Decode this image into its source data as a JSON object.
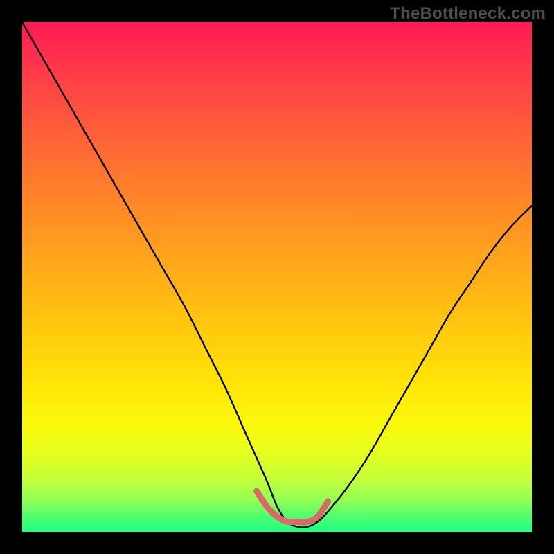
{
  "watermark": "TheBottleneck.com",
  "colors": {
    "frame": "#000000",
    "curve": "#000000",
    "highlight": "#d96a6a",
    "gradient_top": "#ff1a55",
    "gradient_bottom": "#1fff83"
  },
  "chart_data": {
    "type": "line",
    "title": "",
    "xlabel": "",
    "ylabel": "",
    "xlim": [
      0,
      100
    ],
    "ylim": [
      0,
      100
    ],
    "grid": false,
    "legend": false,
    "annotations": [
      "TheBottleneck.com"
    ],
    "series": [
      {
        "name": "bottleneck-curve",
        "x": [
          0,
          4,
          8,
          12,
          16,
          20,
          24,
          28,
          32,
          36,
          40,
          44,
          48,
          50,
          52,
          54,
          56,
          58,
          60,
          64,
          68,
          72,
          76,
          80,
          84,
          88,
          92,
          96,
          100
        ],
        "y": [
          100,
          93,
          86,
          79,
          72,
          65,
          58,
          51,
          44,
          36,
          28,
          19,
          10,
          5,
          2,
          1,
          1,
          2,
          4,
          9,
          15,
          22,
          29,
          36,
          43,
          49,
          55,
          60,
          64
        ]
      },
      {
        "name": "optimal-range-highlight",
        "x": [
          46,
          48,
          50,
          52,
          54,
          56,
          58,
          60
        ],
        "y": [
          8,
          5,
          3,
          2,
          2,
          2,
          3,
          6
        ]
      }
    ]
  }
}
